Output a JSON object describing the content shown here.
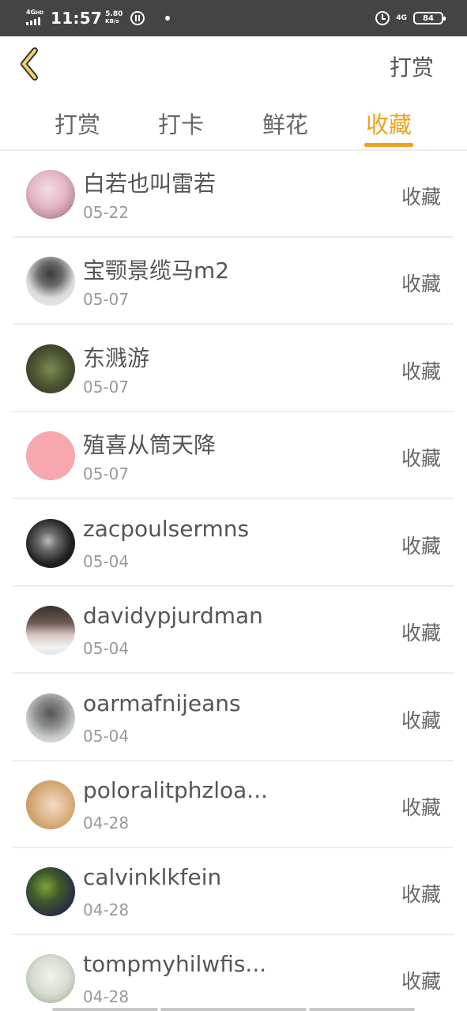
{
  "status_bar": {
    "network": "4G",
    "network_hd": "HD",
    "time": "11:57",
    "speed_value": "5.80",
    "speed_unit": "KB/s",
    "net_right": "4G",
    "battery": "84"
  },
  "header": {
    "back_icon": "chevron-left-icon",
    "title": "打赏"
  },
  "tabs": [
    {
      "label": "打赏",
      "active": false
    },
    {
      "label": "打卡",
      "active": false
    },
    {
      "label": "鲜花",
      "active": false
    },
    {
      "label": "收藏",
      "active": true
    }
  ],
  "accent_color": "#f0a020",
  "list": [
    {
      "name": "白若也叫雷若",
      "date": "05-22",
      "action": "收藏"
    },
    {
      "name": "宝颚景缆马m2",
      "date": "05-07",
      "action": "收藏"
    },
    {
      "name": "东溅游",
      "date": "05-07",
      "action": "收藏"
    },
    {
      "name": "殖喜从筒天降",
      "date": "05-07",
      "action": "收藏"
    },
    {
      "name": "zacpoulsermns",
      "date": "05-04",
      "action": "收藏"
    },
    {
      "name": "davidypjurdman",
      "date": "05-04",
      "action": "收藏"
    },
    {
      "name": "oarmafnijeans",
      "date": "05-04",
      "action": "收藏"
    },
    {
      "name": "poloralitphzloa...",
      "date": "04-28",
      "action": "收藏"
    },
    {
      "name": "calvinklkfein",
      "date": "04-28",
      "action": "收藏"
    },
    {
      "name": "tompmyhilwfis...",
      "date": "04-28",
      "action": "收藏"
    }
  ]
}
